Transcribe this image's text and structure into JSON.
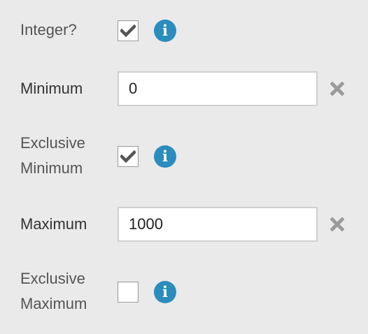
{
  "colors": {
    "background": "#eaeaea",
    "info_accent": "#2b8cbe",
    "checkmark": "#555555",
    "clear_icon": "#9a9a9a"
  },
  "form": {
    "integer": {
      "label": "Integer?",
      "checked": true,
      "info_icon": "i"
    },
    "minimum": {
      "label": "Minimum",
      "value": "0"
    },
    "exclusive_minimum": {
      "label_line1": "Exclusive",
      "label_line2": "Minimum",
      "checked": true,
      "info_icon": "i"
    },
    "maximum": {
      "label": "Maximum",
      "value": "1000"
    },
    "exclusive_maximum": {
      "label_line1": "Exclusive",
      "label_line2": "Maximum",
      "checked": false,
      "info_icon": "i"
    }
  }
}
